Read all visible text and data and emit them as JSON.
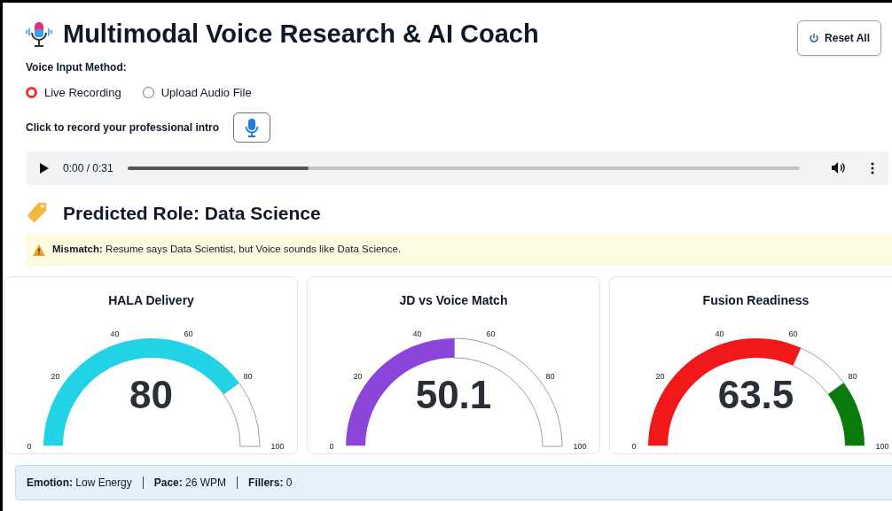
{
  "header": {
    "title": "Multimodal Voice Research & AI Coach",
    "reset_button": "Reset All"
  },
  "input_method": {
    "label": "Voice Input Method:",
    "options": [
      {
        "label": "Live Recording",
        "selected": true
      },
      {
        "label": "Upload Audio File",
        "selected": false
      }
    ]
  },
  "record": {
    "label": "Click to record your professional intro"
  },
  "audio_player": {
    "time": "0:00 / 0:31",
    "level": 0.27
  },
  "prediction": {
    "title": "Predicted Role: Data Science"
  },
  "alert": {
    "label": "Mismatch:",
    "text": "Resume says Data Scientist, but Voice sounds like Data Science."
  },
  "gauges": [
    {
      "title": "HALA Delivery",
      "value": "80",
      "color": "#22d3e6",
      "ticks": [
        "0",
        "20",
        "40",
        "60",
        "80",
        "100"
      ]
    },
    {
      "title": "JD vs Voice Match",
      "value": "50.1",
      "color": "#8b45d9",
      "ticks": [
        "0",
        "20",
        "40",
        "60",
        "80",
        "100"
      ]
    },
    {
      "title": "Fusion Readiness",
      "value": "63.5",
      "color": "#f01818",
      "ticks": [
        "0",
        "20",
        "40",
        "60",
        "80",
        "100"
      ],
      "band": {
        "color": "#0a7a0a"
      }
    }
  ],
  "summary": [
    {
      "label": "Emotion:",
      "value": "Low Energy"
    },
    {
      "label": "Pace:",
      "value": "26 WPM"
    },
    {
      "label": "Fillers:",
      "value": "0"
    }
  ]
}
